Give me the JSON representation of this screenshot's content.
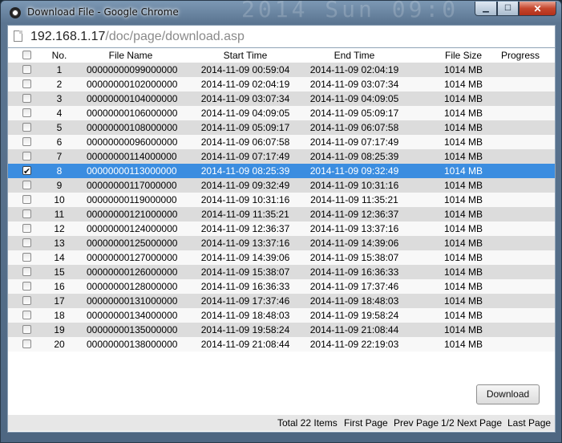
{
  "window": {
    "title": "Download File - Google Chrome",
    "ghost_text": "2014 Sun 09:0"
  },
  "address": {
    "host": "192.168.1.17",
    "path": "/doc/page/download.asp"
  },
  "columns": [
    "No.",
    "File Name",
    "Start Time",
    "End Time",
    "File Size",
    "Progress"
  ],
  "rows": [
    {
      "no": "1",
      "file": "00000000099000000",
      "start": "2014-11-09 00:59:04",
      "end": "2014-11-09 02:04:19",
      "size": "1014 MB",
      "checked": false
    },
    {
      "no": "2",
      "file": "00000000102000000",
      "start": "2014-11-09 02:04:19",
      "end": "2014-11-09 03:07:34",
      "size": "1014 MB",
      "checked": false
    },
    {
      "no": "3",
      "file": "00000000104000000",
      "start": "2014-11-09 03:07:34",
      "end": "2014-11-09 04:09:05",
      "size": "1014 MB",
      "checked": false
    },
    {
      "no": "4",
      "file": "00000000106000000",
      "start": "2014-11-09 04:09:05",
      "end": "2014-11-09 05:09:17",
      "size": "1014 MB",
      "checked": false
    },
    {
      "no": "5",
      "file": "00000000108000000",
      "start": "2014-11-09 05:09:17",
      "end": "2014-11-09 06:07:58",
      "size": "1014 MB",
      "checked": false
    },
    {
      "no": "6",
      "file": "00000000096000000",
      "start": "2014-11-09 06:07:58",
      "end": "2014-11-09 07:17:49",
      "size": "1014 MB",
      "checked": false
    },
    {
      "no": "7",
      "file": "00000000114000000",
      "start": "2014-11-09 07:17:49",
      "end": "2014-11-09 08:25:39",
      "size": "1014 MB",
      "checked": false
    },
    {
      "no": "8",
      "file": "00000000113000000",
      "start": "2014-11-09 08:25:39",
      "end": "2014-11-09 09:32:49",
      "size": "1014 MB",
      "checked": true
    },
    {
      "no": "9",
      "file": "00000000117000000",
      "start": "2014-11-09 09:32:49",
      "end": "2014-11-09 10:31:16",
      "size": "1014 MB",
      "checked": false
    },
    {
      "no": "10",
      "file": "00000000119000000",
      "start": "2014-11-09 10:31:16",
      "end": "2014-11-09 11:35:21",
      "size": "1014 MB",
      "checked": false
    },
    {
      "no": "11",
      "file": "00000000121000000",
      "start": "2014-11-09 11:35:21",
      "end": "2014-11-09 12:36:37",
      "size": "1014 MB",
      "checked": false
    },
    {
      "no": "12",
      "file": "00000000124000000",
      "start": "2014-11-09 12:36:37",
      "end": "2014-11-09 13:37:16",
      "size": "1014 MB",
      "checked": false
    },
    {
      "no": "13",
      "file": "00000000125000000",
      "start": "2014-11-09 13:37:16",
      "end": "2014-11-09 14:39:06",
      "size": "1014 MB",
      "checked": false
    },
    {
      "no": "14",
      "file": "00000000127000000",
      "start": "2014-11-09 14:39:06",
      "end": "2014-11-09 15:38:07",
      "size": "1014 MB",
      "checked": false
    },
    {
      "no": "15",
      "file": "00000000126000000",
      "start": "2014-11-09 15:38:07",
      "end": "2014-11-09 16:36:33",
      "size": "1014 MB",
      "checked": false
    },
    {
      "no": "16",
      "file": "00000000128000000",
      "start": "2014-11-09 16:36:33",
      "end": "2014-11-09 17:37:46",
      "size": "1014 MB",
      "checked": false
    },
    {
      "no": "17",
      "file": "00000000131000000",
      "start": "2014-11-09 17:37:46",
      "end": "2014-11-09 18:48:03",
      "size": "1014 MB",
      "checked": false
    },
    {
      "no": "18",
      "file": "00000000134000000",
      "start": "2014-11-09 18:48:03",
      "end": "2014-11-09 19:58:24",
      "size": "1014 MB",
      "checked": false
    },
    {
      "no": "19",
      "file": "00000000135000000",
      "start": "2014-11-09 19:58:24",
      "end": "2014-11-09 21:08:44",
      "size": "1014 MB",
      "checked": false
    },
    {
      "no": "20",
      "file": "00000000138000000",
      "start": "2014-11-09 21:08:44",
      "end": "2014-11-09 22:19:03",
      "size": "1014 MB",
      "checked": false
    }
  ],
  "selected_row": "8",
  "download_label": "Download",
  "pager": {
    "total": "Total 22 Items",
    "first": "First Page",
    "prev": "Prev Page",
    "pages": "1/2",
    "next": "Next Page",
    "last": "Last Page"
  },
  "colors": {
    "selection": "#3b8de0",
    "stripe": "#dcdcdc"
  }
}
